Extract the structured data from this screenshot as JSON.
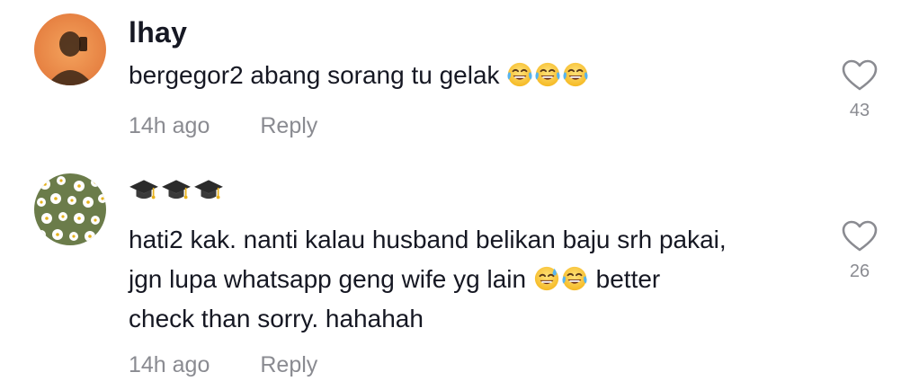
{
  "comments": [
    {
      "username": "lhay",
      "avatar_icon": "person-selfie-avatar",
      "text": "bergegor2 abang sorang tu gelak",
      "emojis": [
        "face-with-tears-of-joy-icon",
        "face-with-tears-of-joy-icon",
        "face-with-tears-of-joy-icon"
      ],
      "time": "14h ago",
      "reply_label": "Reply",
      "likes": "43"
    },
    {
      "username_emojis": [
        "graduation-cap-icon",
        "graduation-cap-icon",
        "graduation-cap-icon"
      ],
      "avatar_icon": "daisy-flowers-avatar",
      "text_line1": "hati2 kak. nanti kalau husband belikan baju srh pakai,",
      "text_line2a": "jgn lupa whatsapp geng wife yg lain",
      "text_line2_emojis": [
        "grinning-face-with-sweat-icon",
        "face-with-tears-of-joy-icon"
      ],
      "text_line2b": "better",
      "text_line3": "check than sorry. hahahah",
      "time": "14h ago",
      "reply_label": "Reply",
      "likes": "26"
    }
  ],
  "colors": {
    "text": "#161823",
    "meta": "#8a8b91",
    "background": "#ffffff"
  }
}
